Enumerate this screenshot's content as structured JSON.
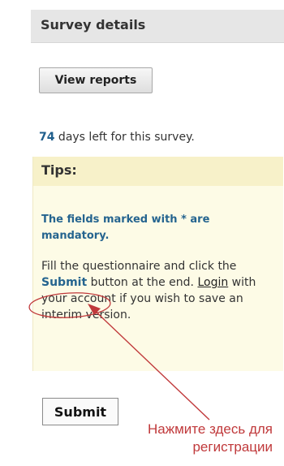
{
  "panel": {
    "title": "Survey details",
    "view_reports_label": "View reports",
    "days_left_count": "74",
    "days_left_text": " days left for this survey."
  },
  "tips": {
    "title": "Tips:",
    "mandatory_note": "The fields marked with * are mandatory.",
    "instructions_part1": "Fill the questionnaire and click the ",
    "instructions_submit_word": "Submit",
    "instructions_part2": " button at the end. ",
    "login_link": "Login",
    "instructions_part3": " with your account if you wish to save an interim version."
  },
  "submit_label": "Submit",
  "annotation": {
    "line1": "Нажмите здесь для",
    "line2": "регистрации",
    "color": "#c0393b"
  },
  "colors": {
    "header_bg": "#e6e6e6",
    "tips_bg": "#fdfbe6",
    "tips_header_bg": "#f7f1c9",
    "link_blue": "#25648f"
  }
}
